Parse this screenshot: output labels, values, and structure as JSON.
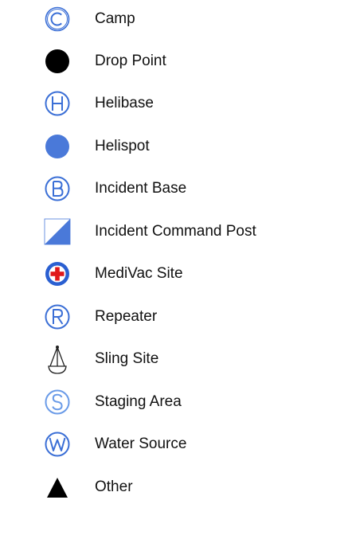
{
  "legend": {
    "items": [
      {
        "label": "Camp",
        "icon": "camp-circle-c-icon",
        "color": "#3b6fd6"
      },
      {
        "label": "Drop Point",
        "icon": "black-dot-icon",
        "color": "#000000"
      },
      {
        "label": "Helibase",
        "icon": "helibase-circle-h-icon",
        "color": "#3b6fd6",
        "glyph": "H"
      },
      {
        "label": "Helispot",
        "icon": "blue-dot-icon",
        "color": "#4a79d9"
      },
      {
        "label": "Incident Base",
        "icon": "incident-base-circle-b-icon",
        "color": "#3b6fd6",
        "glyph": "B"
      },
      {
        "label": "Incident Command Post",
        "icon": "half-square-icon",
        "color": "#4a79d9"
      },
      {
        "label": "MediVac Site",
        "icon": "red-cross-circle-icon",
        "color": "#e0181b"
      },
      {
        "label": "Repeater",
        "icon": "repeater-circle-r-icon",
        "color": "#3b6fd6",
        "glyph": "R"
      },
      {
        "label": "Sling Site",
        "icon": "sling-icon",
        "color": "#222222"
      },
      {
        "label": "Staging Area",
        "icon": "staging-circle-s-icon",
        "color": "#6a9be8",
        "glyph": "S"
      },
      {
        "label": "Water Source",
        "icon": "water-source-circle-w-icon",
        "color": "#3b6fd6",
        "glyph": "W"
      },
      {
        "label": "Other",
        "icon": "black-triangle-icon",
        "color": "#000000"
      }
    ]
  }
}
